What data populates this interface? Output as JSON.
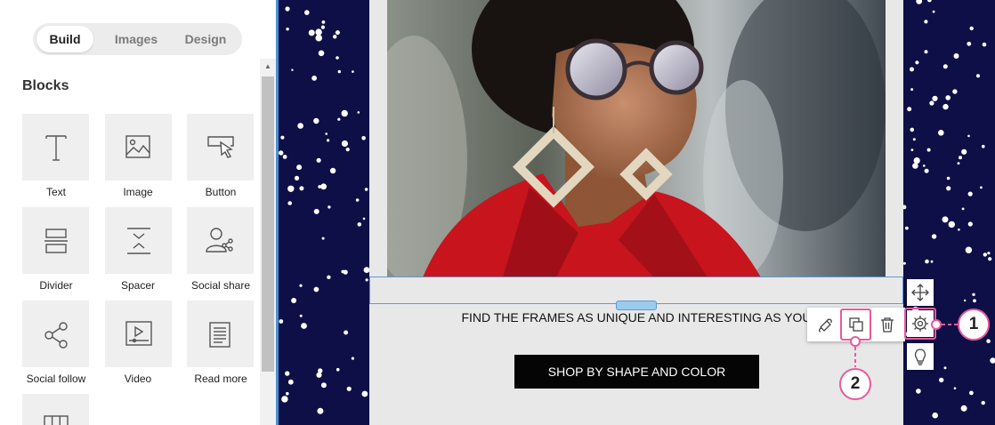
{
  "tabs": [
    {
      "label": "Build",
      "active": true
    },
    {
      "label": "Images",
      "active": false
    },
    {
      "label": "Design",
      "active": false
    }
  ],
  "blocks_title": "Blocks",
  "blocks": [
    {
      "label": "Text",
      "icon": "text-icon"
    },
    {
      "label": "Image",
      "icon": "image-icon"
    },
    {
      "label": "Button",
      "icon": "button-icon"
    },
    {
      "label": "Divider",
      "icon": "divider-icon"
    },
    {
      "label": "Spacer",
      "icon": "spacer-icon"
    },
    {
      "label": "Social share",
      "icon": "social-share-icon"
    },
    {
      "label": "Social follow",
      "icon": "share-icon"
    },
    {
      "label": "Video",
      "icon": "video-icon"
    },
    {
      "label": "Read more",
      "icon": "read-more-icon"
    },
    {
      "label": "",
      "icon": "columns-icon"
    }
  ],
  "email": {
    "headline": "FIND THE FRAMES AS UNIQUE AND INTERESTING AS YOU",
    "cta_label": "SHOP BY SHAPE AND COLOR"
  },
  "block_toolbar": [
    "paint-icon",
    "duplicate-icon",
    "trash-icon"
  ],
  "side_toolbar": [
    "move-icon",
    "gear-icon",
    "lightbulb-icon"
  ],
  "callouts": [
    "1",
    "2"
  ],
  "colors": {
    "canvas_bg": "#0f0f47",
    "highlight": "#e95a9c",
    "selection": "#5c9bd6",
    "cta_bg": "#050505"
  }
}
